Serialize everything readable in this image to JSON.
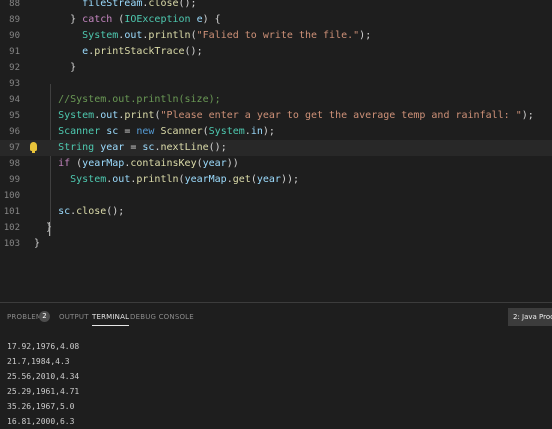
{
  "editor": {
    "lines": [
      {
        "n": "88",
        "tokens": [
          {
            "c": "va",
            "t": "        fileStream"
          },
          {
            "c": "pu",
            "t": "."
          },
          {
            "c": "fn",
            "t": "close"
          },
          {
            "c": "pu",
            "t": "();"
          }
        ]
      },
      {
        "n": "89",
        "tokens": [
          {
            "c": "pu",
            "t": "      } "
          },
          {
            "c": "kw",
            "t": "catch"
          },
          {
            "c": "pu",
            "t": " ("
          },
          {
            "c": "ty",
            "t": "IOException"
          },
          {
            "c": "pu",
            "t": " "
          },
          {
            "c": "va",
            "t": "e"
          },
          {
            "c": "pu",
            "t": ") {"
          }
        ]
      },
      {
        "n": "90",
        "tokens": [
          {
            "c": "ty",
            "t": "        System"
          },
          {
            "c": "pu",
            "t": "."
          },
          {
            "c": "va",
            "t": "out"
          },
          {
            "c": "pu",
            "t": "."
          },
          {
            "c": "fn",
            "t": "println"
          },
          {
            "c": "pu",
            "t": "("
          },
          {
            "c": "st",
            "t": "\"Falied to write the file.\""
          },
          {
            "c": "pu",
            "t": ");"
          }
        ]
      },
      {
        "n": "91",
        "tokens": [
          {
            "c": "va",
            "t": "        e"
          },
          {
            "c": "pu",
            "t": "."
          },
          {
            "c": "fn",
            "t": "printStackTrace"
          },
          {
            "c": "pu",
            "t": "();"
          }
        ]
      },
      {
        "n": "92",
        "tokens": [
          {
            "c": "pu",
            "t": "      }"
          }
        ]
      },
      {
        "n": "93",
        "tokens": []
      },
      {
        "n": "94",
        "tokens": [
          {
            "c": "cm",
            "t": "    //System.out.println(size);"
          }
        ]
      },
      {
        "n": "95",
        "tokens": [
          {
            "c": "ty",
            "t": "    System"
          },
          {
            "c": "pu",
            "t": "."
          },
          {
            "c": "va",
            "t": "out"
          },
          {
            "c": "pu",
            "t": "."
          },
          {
            "c": "fn",
            "t": "print"
          },
          {
            "c": "pu",
            "t": "("
          },
          {
            "c": "st",
            "t": "\"Please enter a year to get the average temp and rainfall: \""
          },
          {
            "c": "pu",
            "t": ");"
          }
        ]
      },
      {
        "n": "96",
        "tokens": [
          {
            "c": "ty",
            "t": "    Scanner"
          },
          {
            "c": "pu",
            "t": " "
          },
          {
            "c": "va",
            "t": "sc"
          },
          {
            "c": "pu",
            "t": " = "
          },
          {
            "c": "kw2",
            "t": "new"
          },
          {
            "c": "pu",
            "t": " "
          },
          {
            "c": "fn",
            "t": "Scanner"
          },
          {
            "c": "pu",
            "t": "("
          },
          {
            "c": "ty",
            "t": "System"
          },
          {
            "c": "pu",
            "t": "."
          },
          {
            "c": "va",
            "t": "in"
          },
          {
            "c": "pu",
            "t": ");"
          }
        ]
      },
      {
        "n": "97",
        "tokens": [
          {
            "c": "ty",
            "t": "    String"
          },
          {
            "c": "pu",
            "t": " "
          },
          {
            "c": "va",
            "t": "year"
          },
          {
            "c": "pu",
            "t": " = "
          },
          {
            "c": "va",
            "t": "sc"
          },
          {
            "c": "pu",
            "t": "."
          },
          {
            "c": "fn",
            "t": "nextLine"
          },
          {
            "c": "pu",
            "t": "();"
          }
        ]
      },
      {
        "n": "98",
        "tokens": [
          {
            "c": "kw",
            "t": "    if"
          },
          {
            "c": "pu",
            "t": " ("
          },
          {
            "c": "va",
            "t": "yearMap"
          },
          {
            "c": "pu",
            "t": "."
          },
          {
            "c": "fn",
            "t": "containsKey"
          },
          {
            "c": "pu",
            "t": "("
          },
          {
            "c": "va",
            "t": "year"
          },
          {
            "c": "pu",
            "t": "))"
          }
        ]
      },
      {
        "n": "99",
        "tokens": [
          {
            "c": "ty",
            "t": "      System"
          },
          {
            "c": "pu",
            "t": "."
          },
          {
            "c": "va",
            "t": "out"
          },
          {
            "c": "pu",
            "t": "."
          },
          {
            "c": "fn",
            "t": "println"
          },
          {
            "c": "pu",
            "t": "("
          },
          {
            "c": "va",
            "t": "yearMap"
          },
          {
            "c": "pu",
            "t": "."
          },
          {
            "c": "fn",
            "t": "get"
          },
          {
            "c": "pu",
            "t": "("
          },
          {
            "c": "va",
            "t": "year"
          },
          {
            "c": "pu",
            "t": "));"
          }
        ]
      },
      {
        "n": "100",
        "tokens": []
      },
      {
        "n": "101",
        "tokens": [
          {
            "c": "va",
            "t": "    sc"
          },
          {
            "c": "pu",
            "t": "."
          },
          {
            "c": "fn",
            "t": "close"
          },
          {
            "c": "pu",
            "t": "();"
          }
        ]
      },
      {
        "n": "102",
        "tokens": [
          {
            "c": "pu",
            "t": "  }"
          }
        ]
      },
      {
        "n": "103",
        "tokens": [
          {
            "c": "pu",
            "t": "}"
          }
        ]
      }
    ],
    "current_line": "97"
  },
  "panel": {
    "tabs": {
      "problems": "PROBLEMS",
      "problems_count": "2",
      "output": "OUTPUT",
      "terminal": "TERMINAL",
      "debug": "DEBUG CONSOLE"
    },
    "terminal_selector": "2: Java Proc",
    "terminal_lines": [
      "17.92,1976,4.08",
      "21.7,1984,4.3",
      "25.56,2010,4.34",
      "25.29,1961,4.71",
      "35.26,1967,5.0",
      "16.81,2000,6.3"
    ]
  },
  "colors": {
    "background": "#1e1e1e",
    "keyword": "#c586c0",
    "type": "#4ec9b0",
    "function": "#dcdcaa",
    "string": "#ce9178",
    "comment": "#6a9955",
    "variable": "#9cdcfe",
    "lightbulb": "#e8c33a"
  },
  "icons": {
    "gutter": "lightbulb-icon"
  }
}
